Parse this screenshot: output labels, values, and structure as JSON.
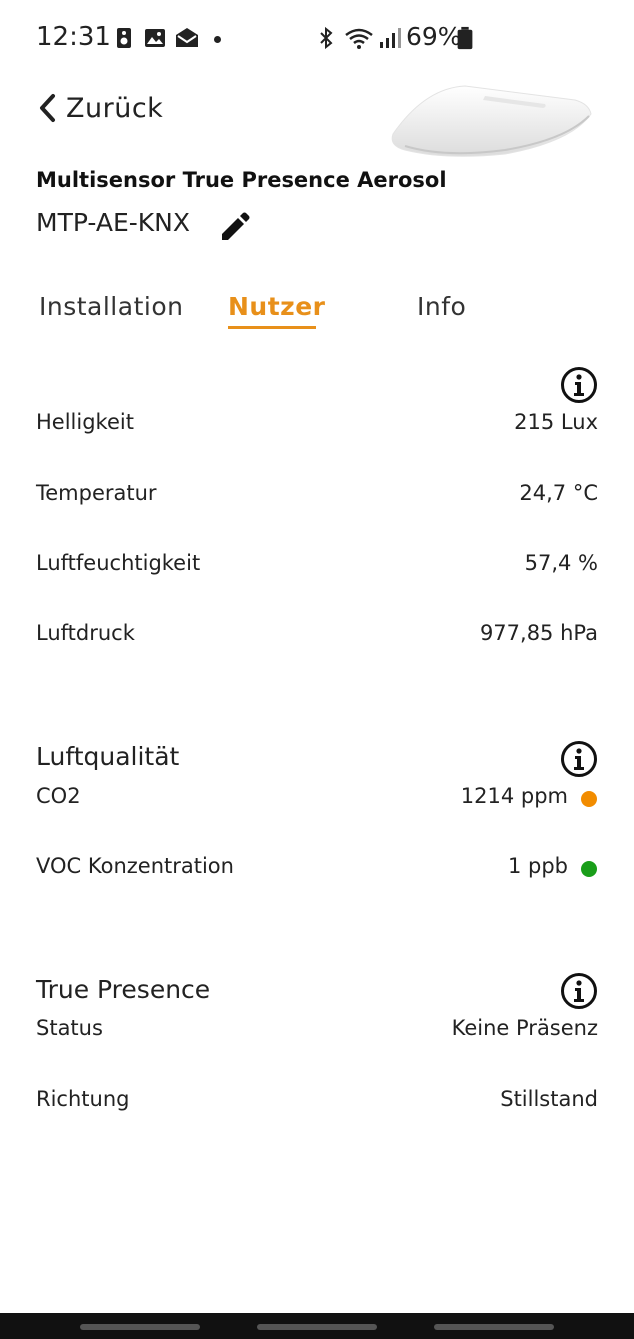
{
  "status_bar": {
    "time": "12:31",
    "battery": "69%",
    "icons": [
      "speaker-icon",
      "image-icon",
      "mail-icon",
      "dot-icon",
      "bluetooth-icon",
      "wifi-icon",
      "signal-icon",
      "battery-icon"
    ]
  },
  "header": {
    "back_label": "Zurück",
    "product_name": "Multisensor True Presence Aerosol",
    "device_name": "MTP-AE-KNX"
  },
  "tabs": [
    {
      "label": "Installation",
      "active": false
    },
    {
      "label": "Nutzer",
      "active": true
    },
    {
      "label": "Info",
      "active": false
    }
  ],
  "sensors": {
    "rows": [
      {
        "label": "Helligkeit",
        "value": "215 Lux"
      },
      {
        "label": "Temperatur",
        "value": "24,7 °C"
      },
      {
        "label": "Luftfeuchtigkeit",
        "value": "57,4 %"
      },
      {
        "label": "Luftdruck",
        "value": "977,85 hPa"
      }
    ]
  },
  "air_quality": {
    "title": "Luftqualität",
    "rows": [
      {
        "label": "CO2",
        "value": "1214 ppm",
        "status_color": "#f28c00"
      },
      {
        "label": "VOC Konzentration",
        "value": "1 ppb",
        "status_color": "#1a9e1a"
      }
    ]
  },
  "presence": {
    "title": "True Presence",
    "rows": [
      {
        "label": "Status",
        "value": "Keine Präsenz"
      },
      {
        "label": "Richtung",
        "value": "Stillstand"
      }
    ]
  },
  "colors": {
    "accent": "#e8901a",
    "text": "#222222",
    "background": "#ffffff"
  }
}
